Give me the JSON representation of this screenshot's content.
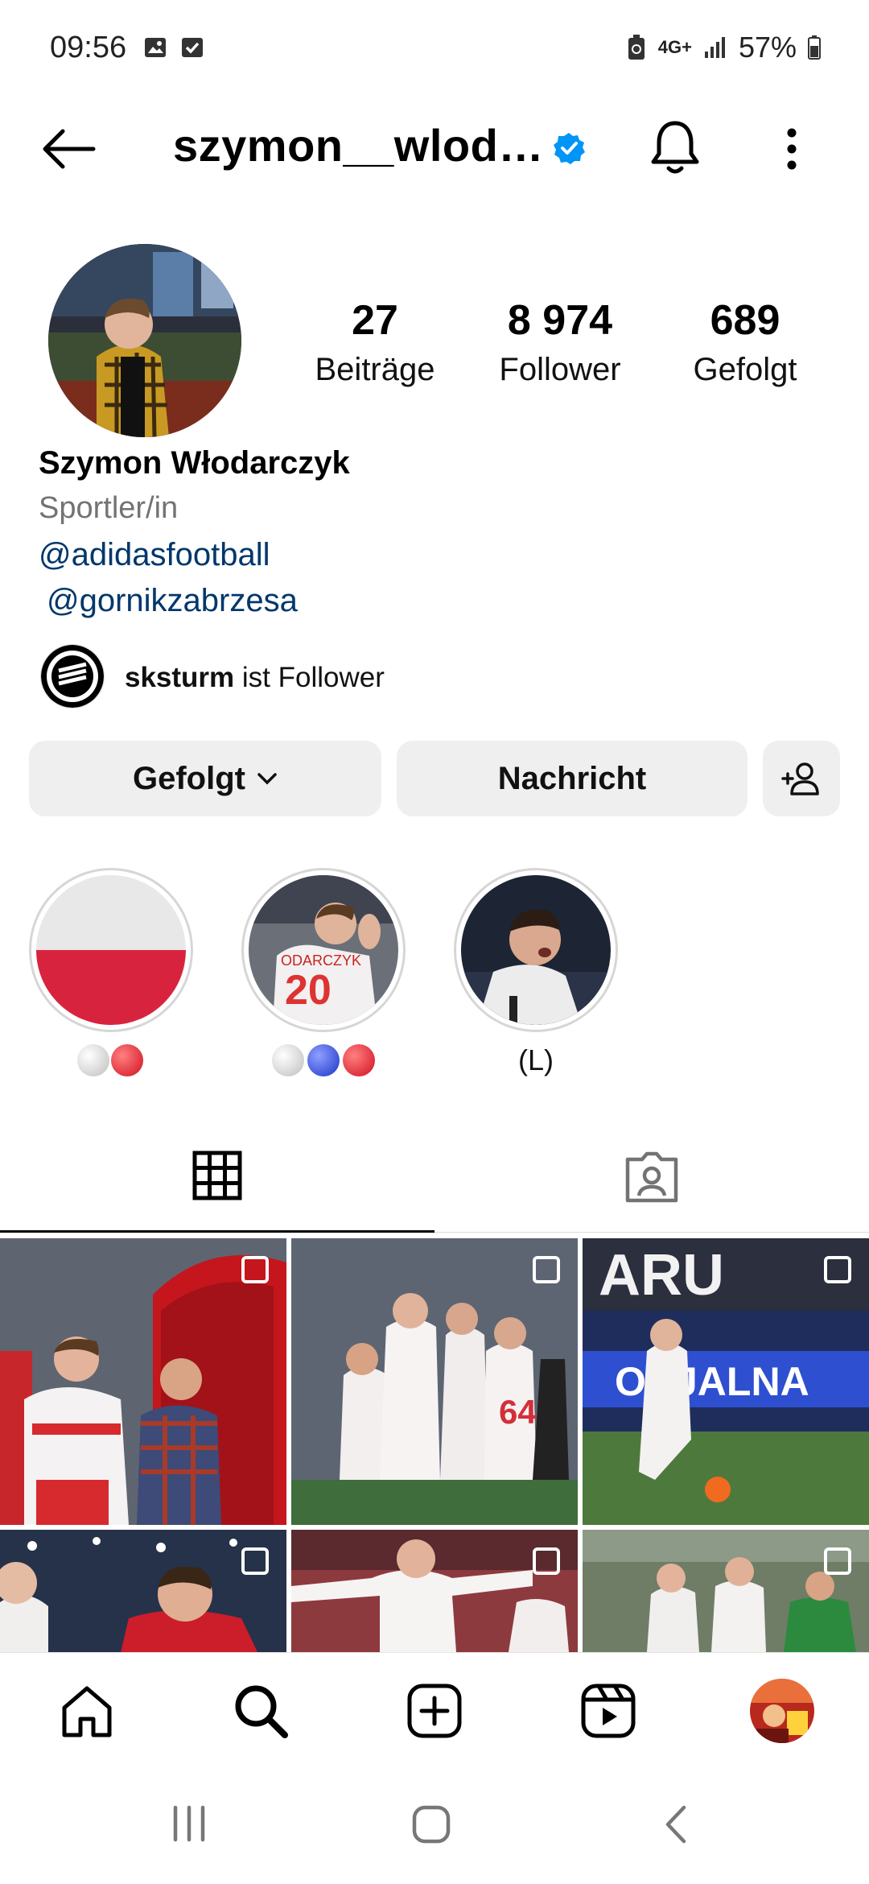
{
  "status": {
    "time": "09:56",
    "network": "4G+",
    "battery": "57%"
  },
  "header": {
    "username": "szymon__wlod…"
  },
  "stats": [
    {
      "value": "27",
      "label": "Beiträge"
    },
    {
      "value": "8 974",
      "label": "Follower"
    },
    {
      "value": "689",
      "label": "Gefolgt"
    }
  ],
  "bio": {
    "name": "Szymon Włodarczyk",
    "category": "Sportler/in",
    "links": [
      "@adidasfootball",
      "@gornikzabrzesa"
    ]
  },
  "followed_by": {
    "user": "sksturm",
    "suffix": " ist Follower"
  },
  "buttons": {
    "following": "Gefolgt",
    "message": "Nachricht"
  },
  "highlights": [
    {
      "label": ""
    },
    {
      "label": ""
    },
    {
      "label": "(L)"
    }
  ],
  "colors": {
    "link": "#00376b",
    "verified": "#0095f6",
    "button_bg": "#efefef",
    "poland_red": "#dc143c"
  }
}
